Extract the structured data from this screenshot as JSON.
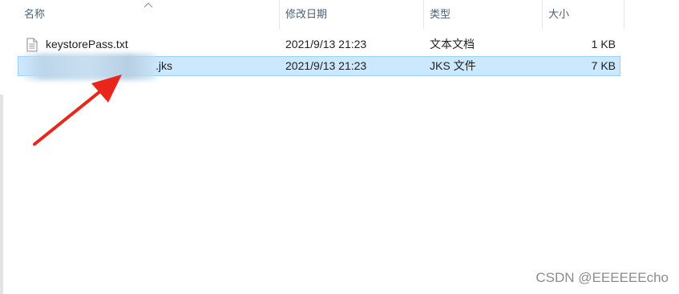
{
  "columns": {
    "name": "名称",
    "modified": "修改日期",
    "type": "类型",
    "size": "大小"
  },
  "files": [
    {
      "name": "keystorePass.txt",
      "modified": "2021/9/13 21:23",
      "type": "文本文档",
      "size": "1 KB",
      "icon": "text-document-icon",
      "selected": false
    },
    {
      "name": ".jks",
      "modified": "2021/9/13 21:23",
      "type": "JKS 文件",
      "size": "7 KB",
      "icon": "blurred-name",
      "selected": true
    }
  ],
  "watermark": "CSDN @EEEEEEcho",
  "colors": {
    "selection_bg": "#cce8ff",
    "selection_border": "#99d1ff",
    "header_text": "#4c607a",
    "arrow": "#e8261b"
  }
}
